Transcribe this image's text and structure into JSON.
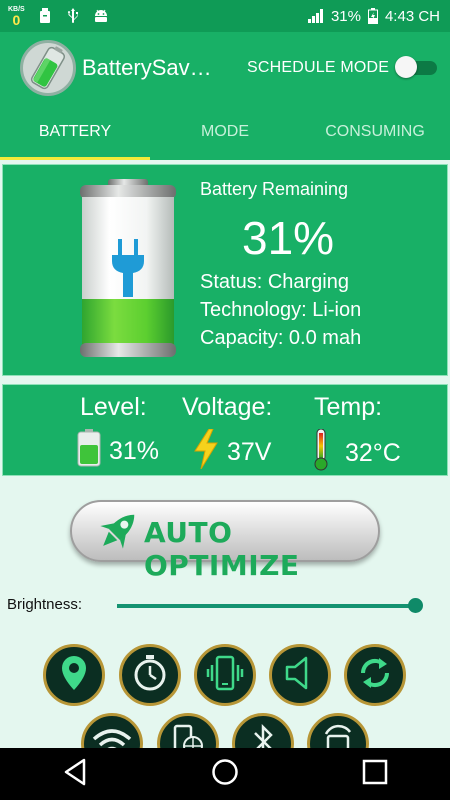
{
  "status_bar": {
    "net_unit": "KB/S",
    "net_value": "0",
    "battery_percent": "31%",
    "time": "4:43 CH",
    "icons": [
      "usb-storage-icon",
      "usb-icon",
      "android-icon",
      "signal-icon",
      "battery-charging-icon"
    ]
  },
  "app_bar": {
    "title": "BatterySav…",
    "schedule_label": "SCHEDULE MODE",
    "schedule_on": false
  },
  "tabs": [
    "BATTERY",
    "MODE",
    "CONSUMING"
  ],
  "battery": {
    "remaining_label": "Battery Remaining",
    "percent": "31%",
    "fill_fraction": 0.31,
    "status": "Status: Charging",
    "technology": "Technology: Li-ion",
    "capacity": "Capacity: 0.0 mah"
  },
  "stats": {
    "level_label": "Level:",
    "level_value": "31%",
    "voltage_label": "Voltage:",
    "voltage_value": "37V",
    "temp_label": "Temp:",
    "temp_value": "32°C"
  },
  "optimize_label": "AUTO OPTIMIZE",
  "brightness": {
    "label": "Brightness:",
    "level": 0.97
  },
  "quick_toggles": [
    "location-icon",
    "timer-icon",
    "vibrate-icon",
    "sound-icon",
    "sync-icon",
    "wifi-icon",
    "data-icon",
    "bluetooth-icon",
    "rotate-icon"
  ],
  "colors": {
    "primary": "#18b066",
    "status_bar": "#0f9b56",
    "accent_yellow": "#f3ea3a",
    "background": "#e4f7ef"
  }
}
